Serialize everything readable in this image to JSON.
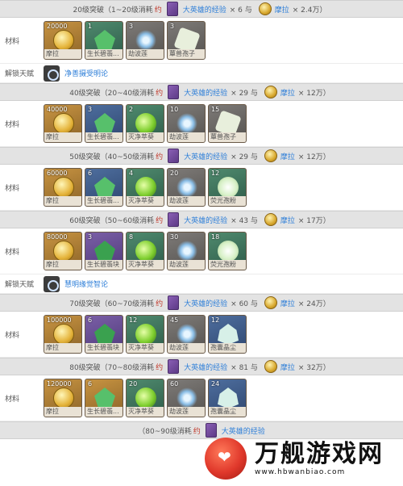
{
  "sections": [
    {
      "header": {
        "prefix": "20级突破（1~20级消耗",
        "hl": "约",
        "exp": "大英雄的经验",
        "exp_count": "× 6 与",
        "mora": "摩拉",
        "mora_count": "× 2.4万）"
      },
      "label": "材料",
      "items": [
        {
          "count": "20000",
          "name": "摩拉",
          "bg": "gold",
          "icon": "coin"
        },
        {
          "count": "1",
          "name": "生长碧翡...",
          "bg": "green",
          "icon": "gem"
        },
        {
          "count": "3",
          "name": "劫波莲",
          "bg": "gray",
          "icon": "flower"
        },
        {
          "count": "3",
          "name": "蕈兽孢子",
          "bg": "gray",
          "icon": "spore"
        }
      ]
    },
    {
      "talent": {
        "label": "解锁天赋",
        "name": "净善摄受明论"
      }
    },
    {
      "header": {
        "prefix": "40级突破（20~40级消耗",
        "hl": "约",
        "exp": "大英雄的经验",
        "exp_count": "× 29 与",
        "mora": "摩拉",
        "mora_count": "× 12万）"
      },
      "label": "材料",
      "items": [
        {
          "count": "40000",
          "name": "摩拉",
          "bg": "gold",
          "icon": "coin"
        },
        {
          "count": "3",
          "name": "生长碧翡...",
          "bg": "blue",
          "icon": "gem"
        },
        {
          "count": "2",
          "name": "灭净萃葵",
          "bg": "green",
          "icon": "orb"
        },
        {
          "count": "10",
          "name": "劫波莲",
          "bg": "gray",
          "icon": "flower"
        },
        {
          "count": "15",
          "name": "蕈兽孢子",
          "bg": "gray",
          "icon": "spore"
        }
      ]
    },
    {
      "header": {
        "prefix": "50级突破（40~50级消耗",
        "hl": "约",
        "exp": "大英雄的经验",
        "exp_count": "× 29 与",
        "mora": "摩拉",
        "mora_count": "× 12万）"
      },
      "label": "材料",
      "items": [
        {
          "count": "60000",
          "name": "摩拉",
          "bg": "gold",
          "icon": "coin"
        },
        {
          "count": "6",
          "name": "生长碧翡...",
          "bg": "blue",
          "icon": "gem"
        },
        {
          "count": "4",
          "name": "灭净萃葵",
          "bg": "green",
          "icon": "orb"
        },
        {
          "count": "20",
          "name": "劫波莲",
          "bg": "gray",
          "icon": "flower"
        },
        {
          "count": "12",
          "name": "荧光孢粉",
          "bg": "green",
          "icon": "glow"
        }
      ]
    },
    {
      "header": {
        "prefix": "60级突破（50~60级消耗",
        "hl": "约",
        "exp": "大英雄的经验",
        "exp_count": "× 43 与",
        "mora": "摩拉",
        "mora_count": "× 17万）"
      },
      "label": "材料",
      "items": [
        {
          "count": "80000",
          "name": "摩拉",
          "bg": "gold",
          "icon": "coin"
        },
        {
          "count": "3",
          "name": "生长碧翡块",
          "bg": "purple",
          "icon": "gem2"
        },
        {
          "count": "8",
          "name": "灭净萃葵",
          "bg": "green",
          "icon": "orb"
        },
        {
          "count": "30",
          "name": "劫波莲",
          "bg": "gray",
          "icon": "flower"
        },
        {
          "count": "18",
          "name": "荧光孢粉",
          "bg": "green",
          "icon": "glow"
        }
      ]
    },
    {
      "talent": {
        "label": "解锁天赋",
        "name": "慧明缘觉智论"
      }
    },
    {
      "header": {
        "prefix": "70级突破（60~70级消耗",
        "hl": "约",
        "exp": "大英雄的经验",
        "exp_count": "× 60 与",
        "mora": "摩拉",
        "mora_count": "× 24万）"
      },
      "label": "材料",
      "items": [
        {
          "count": "100000",
          "name": "摩拉",
          "bg": "gold",
          "icon": "coin"
        },
        {
          "count": "6",
          "name": "生长碧翡块",
          "bg": "purple",
          "icon": "gem2"
        },
        {
          "count": "12",
          "name": "灭净萃葵",
          "bg": "green",
          "icon": "orb"
        },
        {
          "count": "45",
          "name": "劫波莲",
          "bg": "gray",
          "icon": "flower"
        },
        {
          "count": "12",
          "name": "孢囊晶尘",
          "bg": "blue",
          "icon": "crystal"
        }
      ]
    },
    {
      "header": {
        "prefix": "80级突破（70~80级消耗",
        "hl": "约",
        "exp": "大英雄的经验",
        "exp_count": "× 81 与",
        "mora": "摩拉",
        "mora_count": "× 32万）"
      },
      "label": "材料",
      "items": [
        {
          "count": "120000",
          "name": "摩拉",
          "bg": "gold",
          "icon": "coin"
        },
        {
          "count": "6",
          "name": "生长碧翡...",
          "bg": "gold",
          "icon": "gem"
        },
        {
          "count": "20",
          "name": "灭净萃葵",
          "bg": "green",
          "icon": "orb"
        },
        {
          "count": "60",
          "name": "劫波莲",
          "bg": "gray",
          "icon": "flower"
        },
        {
          "count": "24",
          "name": "孢囊晶尘",
          "bg": "blue",
          "icon": "crystal"
        }
      ]
    },
    {
      "header": {
        "prefix": "（80~90级消耗",
        "hl": "约",
        "exp": "大英雄的经验",
        "exp_count": "",
        "mora": "",
        "mora_count": ""
      }
    }
  ],
  "watermark": {
    "title": "万舰游戏网",
    "url": "www.hbwanbiao.com"
  }
}
